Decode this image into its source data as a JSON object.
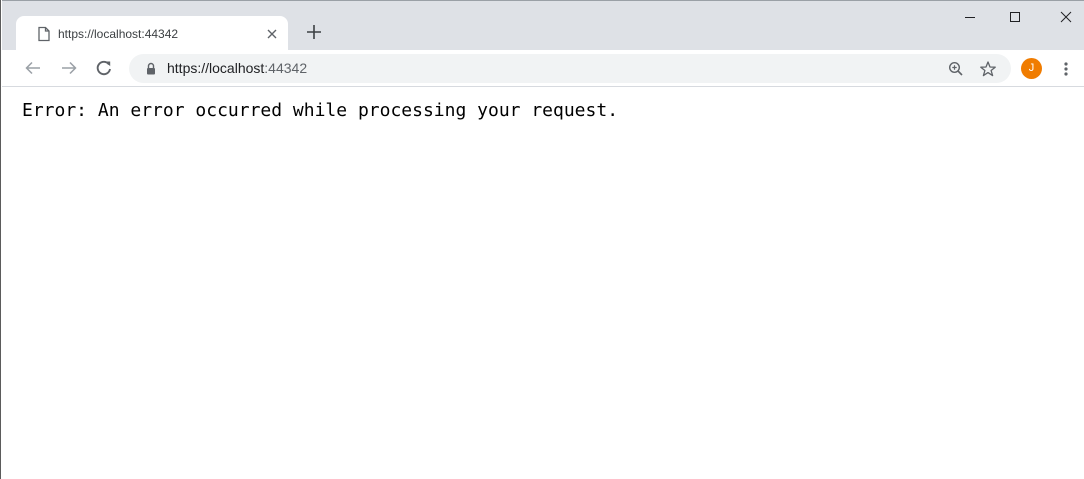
{
  "tab": {
    "title": "https://localhost:44342",
    "icon": "page-icon",
    "close_icon": "close-icon"
  },
  "new_tab_icon": "plus-icon",
  "window_controls": [
    "minimize-icon",
    "maximize-icon",
    "close-icon"
  ],
  "toolbar": {
    "back_icon": "back-arrow-icon",
    "forward_icon": "forward-arrow-icon",
    "reload_icon": "reload-icon"
  },
  "omnibox": {
    "secure_icon": "lock-icon",
    "url_main": "https://localhost",
    "url_rest": ":44342",
    "zoom_icon": "zoom-icon",
    "bookmark_icon": "star-icon"
  },
  "profile": {
    "initial": "J",
    "color": "#f07c00"
  },
  "menu_icon": "more-vertical-icon",
  "page": {
    "message": "Error: An error occurred while processing your request."
  },
  "colors": {
    "tabstrip_bg": "#dee1e6",
    "omnibox_bg": "#f1f3f4"
  }
}
